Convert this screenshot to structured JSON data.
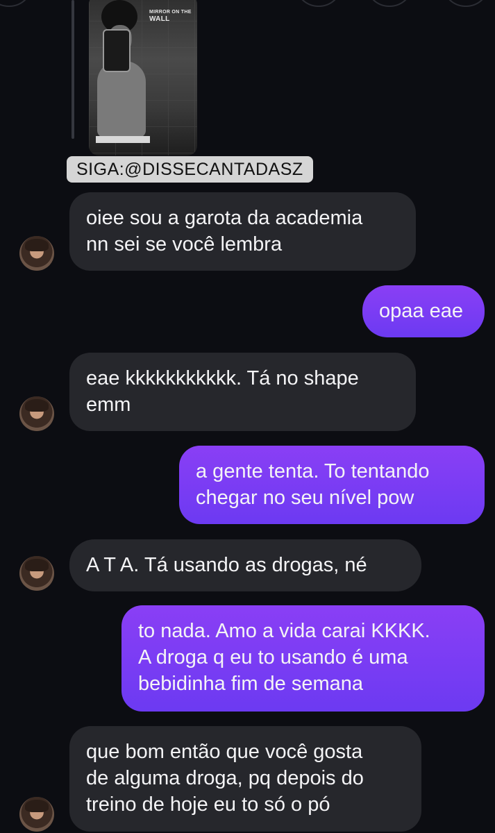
{
  "story": {
    "caption_top": "MIRROR ON THE",
    "caption_bottom": "WALL",
    "tag": "SIGA:@DISSECANTADASZ"
  },
  "messages": [
    {
      "direction": "incoming",
      "lines": [
        "oiee sou a garota da academia",
        "nn sei se você lembra"
      ]
    },
    {
      "direction": "outgoing",
      "lines": [
        "opaa eae"
      ]
    },
    {
      "direction": "incoming",
      "lines": [
        "eae kkkkkkkkkkk. Tá no shape",
        "emm"
      ]
    },
    {
      "direction": "outgoing",
      "lines": [
        "a gente tenta. To tentando",
        "chegar no seu nível pow"
      ]
    },
    {
      "direction": "incoming",
      "lines": [
        "A T A.  Tá usando as drogas, né"
      ]
    },
    {
      "direction": "outgoing",
      "lines": [
        "to nada. Amo a vida carai KKKK.",
        "A droga q eu to usando é uma",
        "bebidinha fim de semana"
      ]
    },
    {
      "direction": "incoming",
      "lines": [
        "que bom então que você gosta",
        "de alguma droga, pq depois do",
        "treino de hoje eu to só o pó"
      ]
    }
  ],
  "colors": {
    "background": "#0c0d12",
    "incoming_bubble": "#26272c",
    "outgoing_bubble": "#7b3df4"
  }
}
